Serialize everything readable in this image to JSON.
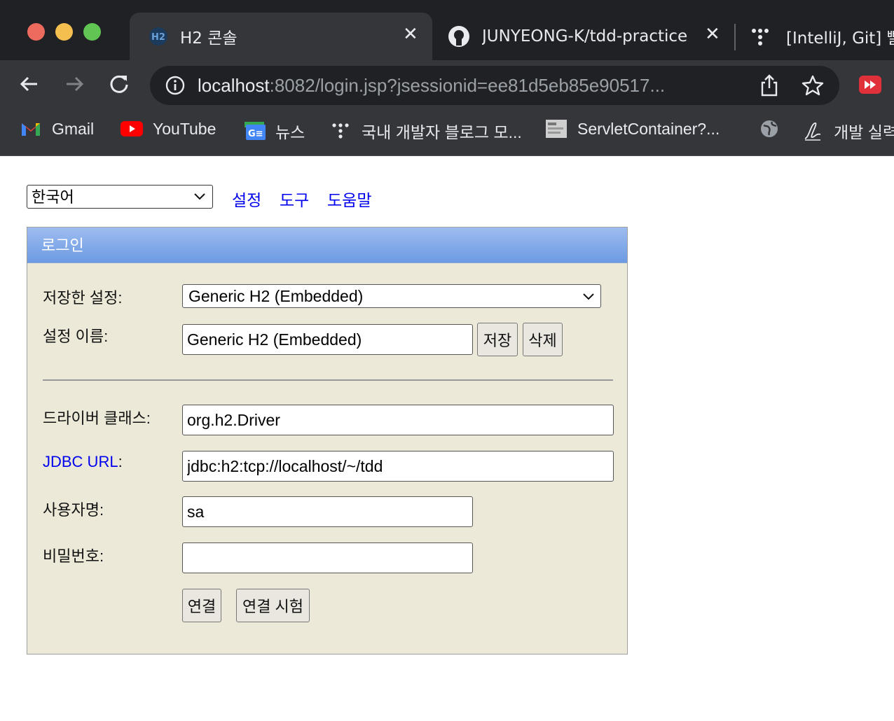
{
  "browser": {
    "tabs": [
      {
        "title": "H2 콘솔",
        "active": true
      },
      {
        "title": "JUNYEONG-K/tdd-practice",
        "active": false
      },
      {
        "title": "[IntelliJ, Git] 빨",
        "active": false
      }
    ],
    "url_host": "localhost",
    "url_rest": ":8082/login.jsp?jsessionid=ee81d5eb85e90517...",
    "bookmarks": [
      {
        "label": "Gmail",
        "icon": "gmail-icon"
      },
      {
        "label": "YouTube",
        "icon": "youtube-icon"
      },
      {
        "label": "뉴스",
        "icon": "news-icon"
      },
      {
        "label": "국내 개발자 블로그 모...",
        "icon": "dots-icon"
      },
      {
        "label": "ServletContainer?...",
        "icon": "page-thumbnail-icon"
      },
      {
        "label": "",
        "icon": "globe-icon"
      },
      {
        "label": "개발 실력",
        "icon": "signature-icon"
      }
    ]
  },
  "page": {
    "language": "한국어",
    "links": [
      "설정",
      "도구",
      "도움말"
    ],
    "panel_title": "로그인",
    "saved_settings_label": "저장한 설정:",
    "saved_settings_value": "Generic H2 (Embedded)",
    "setting_name_label": "설정 이름:",
    "setting_name_value": "Generic H2 (Embedded)",
    "save_button": "저장",
    "delete_button": "삭제",
    "driver_label": "드라이버 클래스:",
    "driver_value": "org.h2.Driver",
    "jdbc_label": "JDBC URL",
    "jdbc_colon": ":",
    "jdbc_value": "jdbc:h2:tcp://localhost/~/tdd",
    "user_label": "사용자명:",
    "user_value": "sa",
    "password_label": "비밀번호:",
    "password_value": "",
    "connect_button": "연결",
    "test_button": "연결 시험"
  }
}
